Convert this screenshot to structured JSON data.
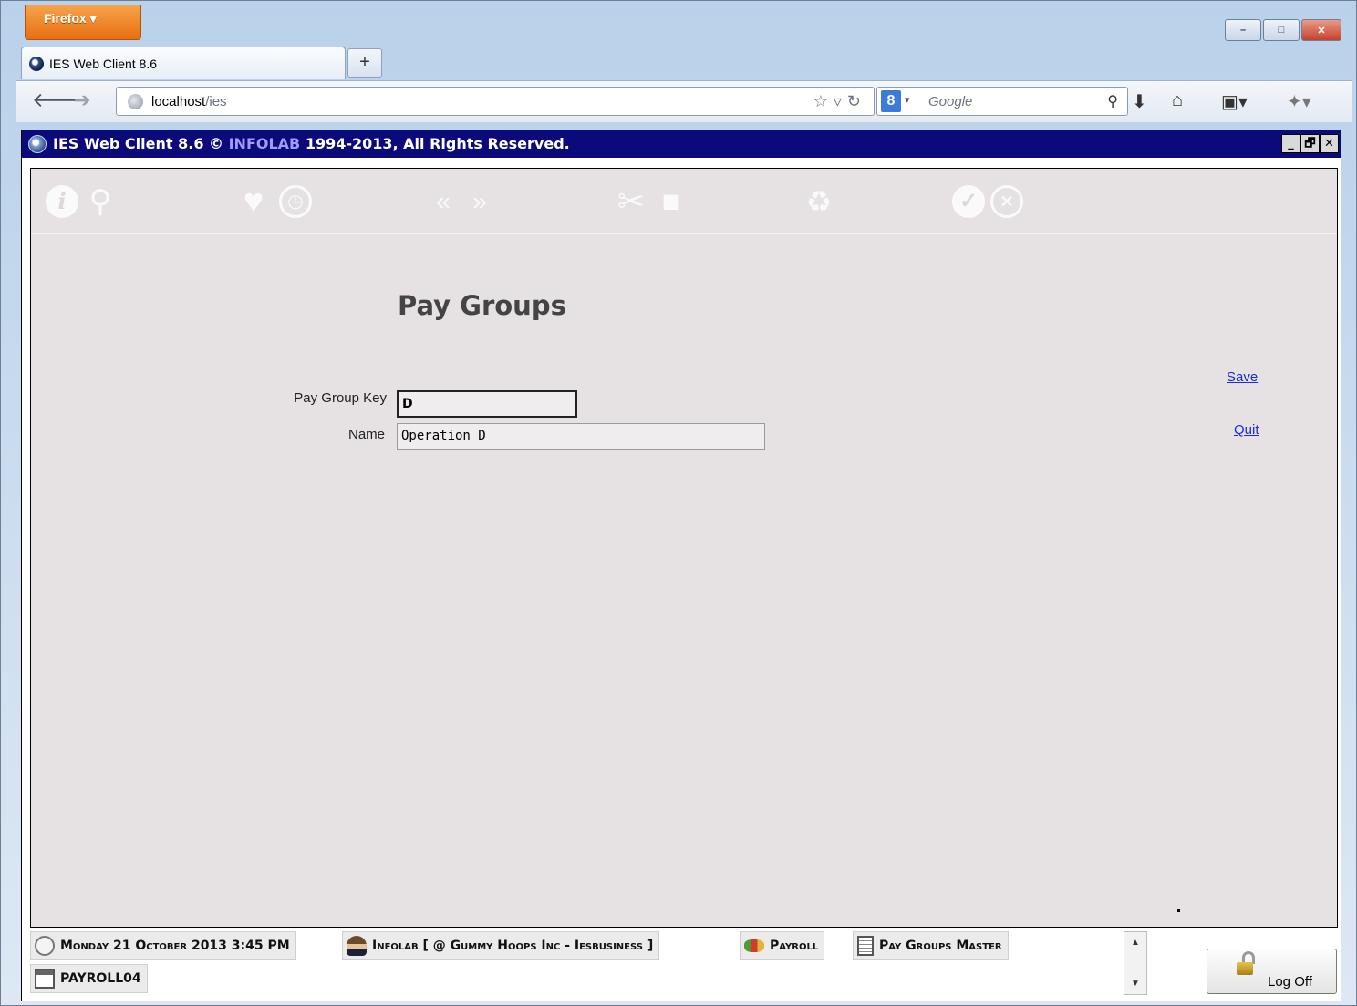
{
  "browser": {
    "menu_button": "Firefox ▾",
    "tab_title": "IES Web Client 8.6",
    "new_tab": "+",
    "url_host": "localhost",
    "url_path": "/ies",
    "search_engine_glyph": "8",
    "search_placeholder": "Google",
    "window_controls": [
      "–",
      "□",
      "✕"
    ]
  },
  "app": {
    "title_prefix": "IES Web Client 8.6 © ",
    "title_brand": "INFOLAB",
    "title_suffix": " 1994-2013, All Rights Reserved.",
    "window_controls": [
      "_",
      "🗗",
      "✕"
    ]
  },
  "toolbar": {
    "icons": [
      "info-icon",
      "search-icon",
      "favorite-icon",
      "history-icon",
      "previous-icon",
      "next-icon",
      "tools-icon",
      "stop-icon",
      "recycle-icon",
      "accept-icon",
      "cancel-icon"
    ]
  },
  "form": {
    "title": "Pay Groups",
    "key_label": "Pay Group Key",
    "key_value": "D",
    "name_label": "Name",
    "name_value": "Operation D"
  },
  "actions": {
    "save": "Save",
    "quit": "Quit"
  },
  "status": {
    "datetime": "Monday 21 October 2013 3:45 PM",
    "user": "Infolab [ @ Gummy Hoops Inc - Iesbusiness ]",
    "module": "Payroll",
    "screen": "Pay Groups Master",
    "program": "PAYROLL04",
    "logoff": "Log Off"
  },
  "colors": {
    "app_titlebar": "#0a0a7a",
    "app_background": "#e6e2e4",
    "link": "#1b2bd6"
  }
}
